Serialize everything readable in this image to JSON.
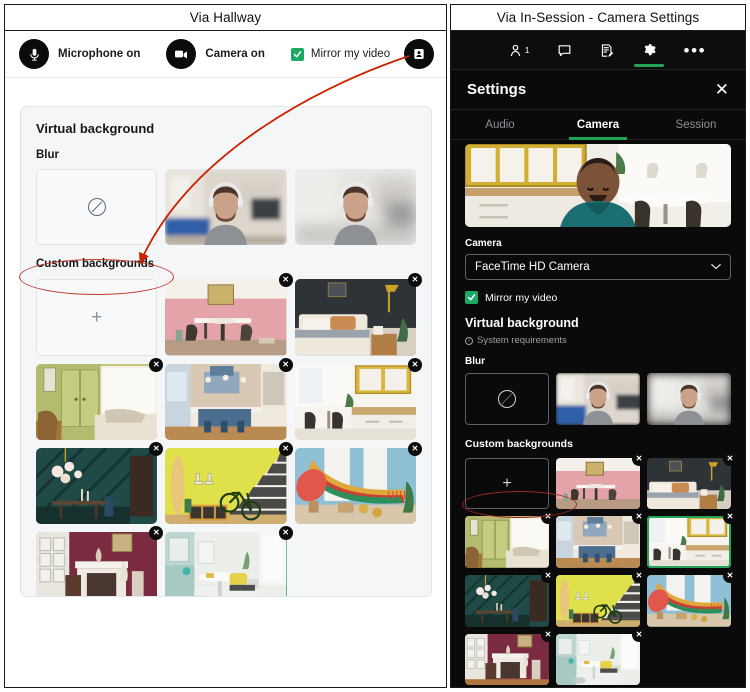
{
  "panels": {
    "left_caption": "Via Hallway",
    "right_caption": "Via In-Session - Camera Settings"
  },
  "hallway": {
    "toolbar": {
      "microphone_label": "Microphone on",
      "microphone_icon": "microphone-icon",
      "camera_label": "Camera on",
      "camera_icon": "video-camera-icon",
      "mirror_label": "Mirror my video",
      "mirror_checked": true,
      "avatar_icon": "person-badge-icon"
    },
    "virtual_background": {
      "title": "Virtual background",
      "blur_label": "Blur",
      "custom_label": "Custom backgrounds",
      "none_icon": "no-effect-icon",
      "add_icon": "plus-icon",
      "blur_options": [
        {
          "name": "none",
          "type": "none"
        },
        {
          "name": "slight-blur",
          "type": "person-office-slight-blur"
        },
        {
          "name": "full-blur",
          "type": "person-office-full-blur"
        }
      ],
      "custom_backgrounds": [
        {
          "name": "add-background",
          "type": "add",
          "removable": false,
          "selected": false
        },
        {
          "name": "pink-dining-room",
          "type": "image",
          "removable": true,
          "selected": false
        },
        {
          "name": "dark-bedroom",
          "type": "image",
          "removable": true,
          "selected": false
        },
        {
          "name": "green-hallway-bench",
          "type": "image",
          "removable": true,
          "selected": false
        },
        {
          "name": "blue-kitchen-island",
          "type": "image",
          "removable": true,
          "selected": false
        },
        {
          "name": "yellow-cabinet-kitchen",
          "type": "image",
          "removable": true,
          "selected": false
        },
        {
          "name": "teal-geometric-dining",
          "type": "image",
          "removable": true,
          "selected": false
        },
        {
          "name": "yellow-stairs-bike",
          "type": "image",
          "removable": true,
          "selected": false
        },
        {
          "name": "hammock-sunroom",
          "type": "image",
          "removable": true,
          "selected": false
        },
        {
          "name": "burgundy-fireplace",
          "type": "image",
          "removable": true,
          "selected": false
        },
        {
          "name": "mint-breakfast-nook",
          "type": "image",
          "removable": true,
          "selected": true
        }
      ],
      "delete_badge_glyph": "✕"
    }
  },
  "session": {
    "toolbar": {
      "participants_icon": "person-icon",
      "participants_count": "1",
      "chat_icon": "chat-bubble-icon",
      "notes_icon": "notes-icon",
      "settings_icon": "gear-icon",
      "more_icon": "ellipsis-icon",
      "active_item": "settings"
    },
    "header": {
      "title": "Settings",
      "close_icon": "close-icon",
      "close_glyph": "✕"
    },
    "tabs": [
      {
        "label": "Audio",
        "active": false
      },
      {
        "label": "Camera",
        "active": true
      },
      {
        "label": "Session",
        "active": false
      }
    ],
    "camera": {
      "camera_field_label": "Camera",
      "camera_value": "FaceTime HD Camera",
      "chevron_icon": "chevron-down-icon",
      "chevron_glyph": "⌄",
      "mirror_label": "Mirror my video",
      "mirror_checked": true,
      "virtual_background_title": "Virtual background",
      "system_requirements_label": "System requirements",
      "info_icon": "info-icon",
      "info_glyph": "i",
      "blur_label": "Blur",
      "custom_label": "Custom backgrounds",
      "blur_options": [
        {
          "name": "none",
          "type": "none"
        },
        {
          "name": "slight-blur",
          "type": "person-office-slight-blur"
        },
        {
          "name": "full-blur",
          "type": "person-office-full-blur"
        }
      ],
      "custom_backgrounds": [
        {
          "name": "add-background",
          "type": "add",
          "removable": false,
          "selected": false
        },
        {
          "name": "pink-dining-room",
          "type": "image",
          "removable": true,
          "selected": false
        },
        {
          "name": "dark-bedroom",
          "type": "image",
          "removable": true,
          "selected": false
        },
        {
          "name": "green-hallway-bench",
          "type": "image",
          "removable": true,
          "selected": false
        },
        {
          "name": "blue-kitchen-island",
          "type": "image",
          "removable": true,
          "selected": false
        },
        {
          "name": "yellow-cabinet-kitchen",
          "type": "image",
          "removable": true,
          "selected": true
        },
        {
          "name": "teal-geometric-dining",
          "type": "image",
          "removable": true,
          "selected": false
        },
        {
          "name": "yellow-stairs-bike",
          "type": "image",
          "removable": true,
          "selected": false
        },
        {
          "name": "hammock-sunroom",
          "type": "image",
          "removable": true,
          "selected": false
        },
        {
          "name": "burgundy-fireplace",
          "type": "image",
          "removable": true,
          "selected": false
        },
        {
          "name": "mint-breakfast-nook",
          "type": "image",
          "removable": true,
          "selected": false
        }
      ],
      "delete_badge_glyph": "✕",
      "preview_scene": "yellow-cabinet-kitchen"
    }
  },
  "annotations": {
    "arrow_color": "#cc2200",
    "ellipse_color": "#c0392b",
    "accent_green": "#22a357",
    "selection_green": "#1d8f6e"
  }
}
